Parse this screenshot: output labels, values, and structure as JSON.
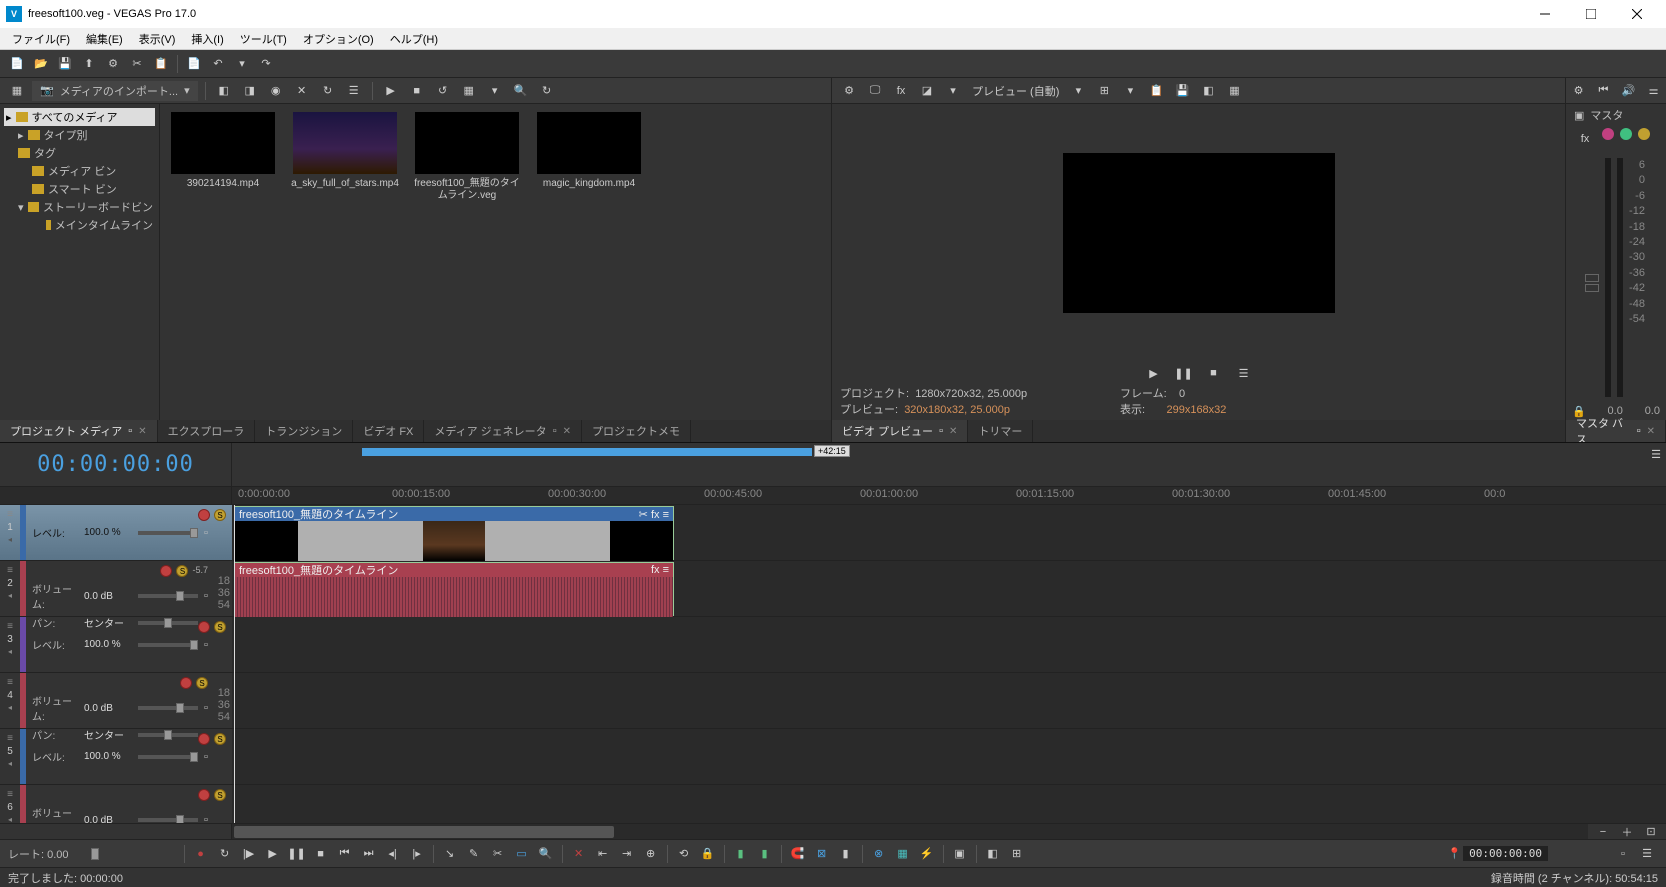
{
  "window": {
    "title": "freesoft100.veg - VEGAS Pro 17.0",
    "logo_text": "V"
  },
  "menu": {
    "file": "ファイル(F)",
    "edit": "編集(E)",
    "view": "表示(V)",
    "insert": "挿入(I)",
    "tools": "ツール(T)",
    "options": "オプション(O)",
    "help": "ヘルプ(H)"
  },
  "media_panel": {
    "import_label": "メディアのインポート...",
    "tree": {
      "all_media": "すべてのメディア",
      "by_type": "タイプ別",
      "tags": "タグ",
      "media_bin": "メディア ビン",
      "smart_bin": "スマート ビン",
      "storyboard_bin": "ストーリーボードビン",
      "main_timeline": "メインタイムライン"
    },
    "items": [
      "390214194.mp4",
      "a_sky_full_of_stars.mp4",
      "freesoft100_無題のタイムライン.veg",
      "magic_kingdom.mp4"
    ]
  },
  "left_tabs": {
    "project_media": "プロジェクト メディア",
    "explorer": "エクスプローラ",
    "transitions": "トランジション",
    "video_fx": "ビデオ FX",
    "media_generators": "メディア ジェネレータ",
    "project_notes": "プロジェクトメモ"
  },
  "preview": {
    "quality_label": "プレビュー (自動)",
    "project_label": "プロジェクト:",
    "project_value": "1280x720x32, 25.000p",
    "preview_label": "プレビュー:",
    "preview_value": "320x180x32, 25.000p",
    "frame_label": "フレーム:",
    "frame_value": "0",
    "display_label": "表示:",
    "display_value": "299x168x32",
    "tab_video_preview": "ビデオ プレビュー",
    "tab_trimmer": "トリマー"
  },
  "master": {
    "title": "マスタ",
    "scale": [
      "6",
      "0",
      "-6",
      "-12",
      "-18",
      "-24",
      "-30",
      "-36",
      "-42",
      "-48",
      "-54"
    ],
    "left_val": "0.0",
    "right_val": "0.0",
    "tab": "マスタ バス"
  },
  "timeline": {
    "timecode_main": "00:00:00:00",
    "marker_tooltip": "+42:15",
    "ruler": [
      "0:00:00:00",
      "00:00:15:00",
      "00:00:30:00",
      "00:00:45:00",
      "00:01:00:00",
      "00:01:15:00",
      "00:01:30:00",
      "00:01:45:00",
      "00:0"
    ],
    "tracks": [
      {
        "num": "1",
        "type": "video",
        "label": "レベル:",
        "value": "100.0 %"
      },
      {
        "num": "2",
        "type": "audio",
        "label": "ボリューム:",
        "value": "0.0 dB",
        "label2": "パン:",
        "value2": "センター",
        "peak": "-5.7",
        "scale": [
          "18",
          "36",
          "54"
        ]
      },
      {
        "num": "3",
        "type": "video-dark",
        "label": "レベル:",
        "value": "100.0 %"
      },
      {
        "num": "4",
        "type": "audio",
        "label": "ボリューム:",
        "value": "0.0 dB",
        "label2": "パン:",
        "value2": "センター",
        "scale": [
          "18",
          "36",
          "54"
        ]
      },
      {
        "num": "5",
        "type": "video-dark",
        "label": "レベル:",
        "value": "100.0 %"
      },
      {
        "num": "6",
        "type": "audio",
        "label": "ボリューム:",
        "value": "0.0 dB"
      }
    ],
    "clip_video_name": "freesoft100_無題のタイムライン",
    "clip_audio_name": "freesoft100_無題のタイムライン",
    "rate_label": "レート:",
    "rate_value": "0.00",
    "timecode_small": "00:00:00:00"
  },
  "status": {
    "left": "完了しました: 00:00:00",
    "right": "録音時間 (2 チャンネル): 50:54:15"
  }
}
